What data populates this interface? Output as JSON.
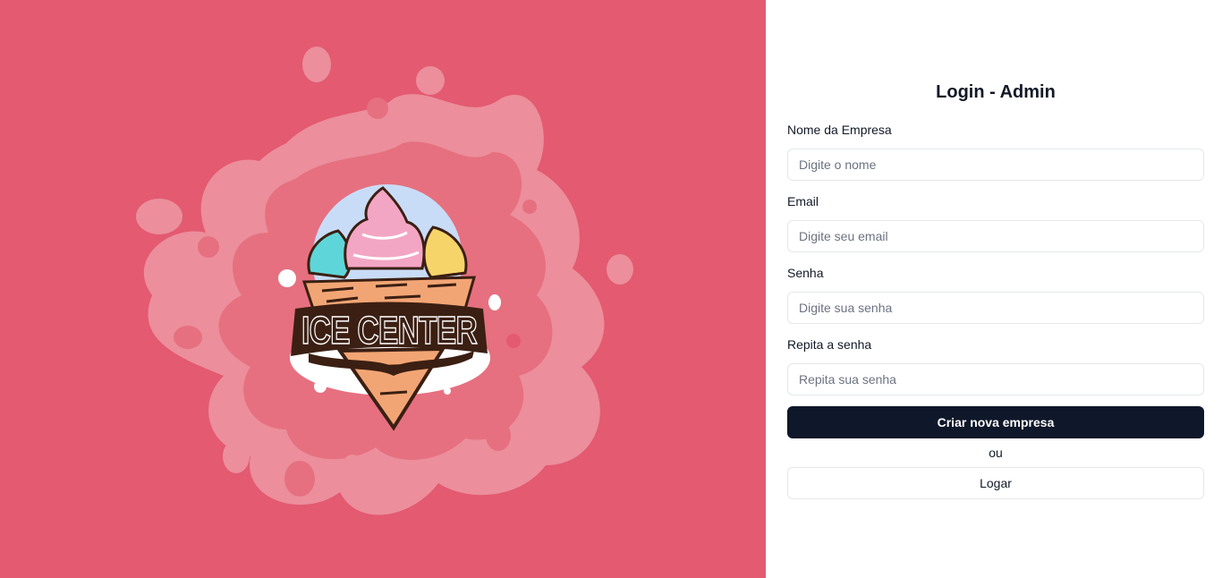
{
  "hero": {
    "logo_text": "ICE CENTER"
  },
  "form": {
    "title": "Login - Admin",
    "fields": [
      {
        "label": "Nome da Empresa",
        "placeholder": "Digite o nome",
        "value": ""
      },
      {
        "label": "Email",
        "placeholder": "Digite seu email",
        "value": ""
      },
      {
        "label": "Senha",
        "placeholder": "Digite sua senha",
        "value": ""
      },
      {
        "label": "Repita a senha",
        "placeholder": "Repita sua senha",
        "value": ""
      }
    ],
    "submit_label": "Criar nova empresa",
    "or_text": "ou",
    "login_label": "Logar"
  },
  "colors": {
    "hero_background": "#e35a71",
    "splash_light": "#ec8e9c",
    "splash_mid": "#e6707f",
    "primary_button": "#0f172a",
    "logo_dark": "#3b1f13"
  }
}
